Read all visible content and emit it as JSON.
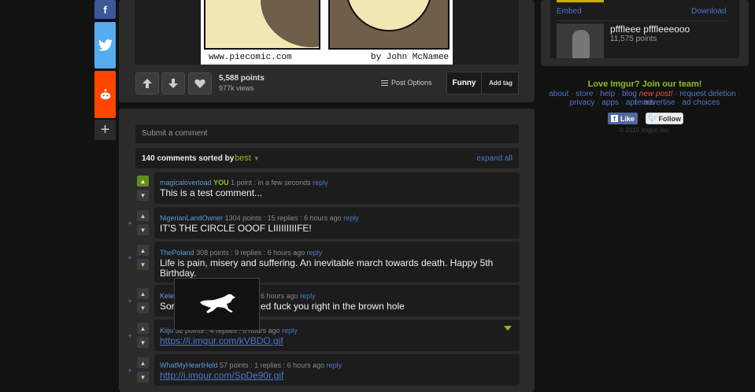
{
  "image": {
    "url_text": "www.piecomic.com",
    "credit": "by John McNamee"
  },
  "post": {
    "points": "5,588 points",
    "views": "977k views",
    "options_label": "Post Options",
    "tag_label": "Funny",
    "add_tag_label": "Add tag"
  },
  "comments_section": {
    "submit_placeholder": "Submit a comment",
    "count_text": "140 comments sorted by",
    "sort_value": "best",
    "expand_label": "expand all"
  },
  "comments": [
    {
      "user": "magicaloverload",
      "you": "YOU",
      "stats": "1 point : in a few seconds",
      "reply": "reply",
      "text": "This is a test comment...",
      "plus": ""
    },
    {
      "user": "NigerianLandOwner",
      "stats": "1304 points : 15 replies : 6 hours ago",
      "reply": "reply",
      "text": "IT'S THE CIRCLE OOOF LIIIIIIIIIFE!",
      "plus": "+"
    },
    {
      "user": "ThePoland",
      "stats": "308 points : 9 replies : 6 hours ago",
      "reply": "reply",
      "text": "Life is pain, misery and suffering. An inevitable march towards death. Happy 5th",
      "text2": "Birthday.",
      "plus": "+"
    },
    {
      "user": "Kele",
      "stats": "6 hours ago",
      "reply": "reply",
      "text": "Sor",
      "text_right": "ed fuck you right in the brown hole",
      "plus": "+"
    },
    {
      "user": "Kiiju",
      "stats": "32 points : 4 replies : 6 hours ago",
      "reply": "reply",
      "text": "https://i.imgur.com/kVBDO.gif",
      "plus": "+"
    },
    {
      "user": "WhatMyHeartHeld",
      "stats": "57 points : 1 replies : 6 hours ago",
      "reply": "reply",
      "text": "http://i.imgur.com/SpDe90r.gif",
      "plus": "+"
    }
  ],
  "sidebar": {
    "embed_label": "Embed",
    "download_label": "Download",
    "related_title": "pfffleee pfffleeeooo",
    "related_points": "11,575 points",
    "join_text": "Love Imgur? Join our team!",
    "links_row1": [
      "about",
      "store",
      "help",
      "blog",
      "new post!",
      "request deletion",
      "terms"
    ],
    "links_row2": [
      "privacy",
      "apps",
      "api",
      "advertise",
      "ad choices"
    ],
    "fb_like": "Like",
    "tw_follow": "Follow",
    "copyright": "© 2015 Imgur, Inc."
  },
  "colors": {
    "accent_green": "#8fbf1a",
    "link_blue": "#4e76c9",
    "twitter_blue": "#55acee",
    "reddit_orange": "#ff4500"
  }
}
